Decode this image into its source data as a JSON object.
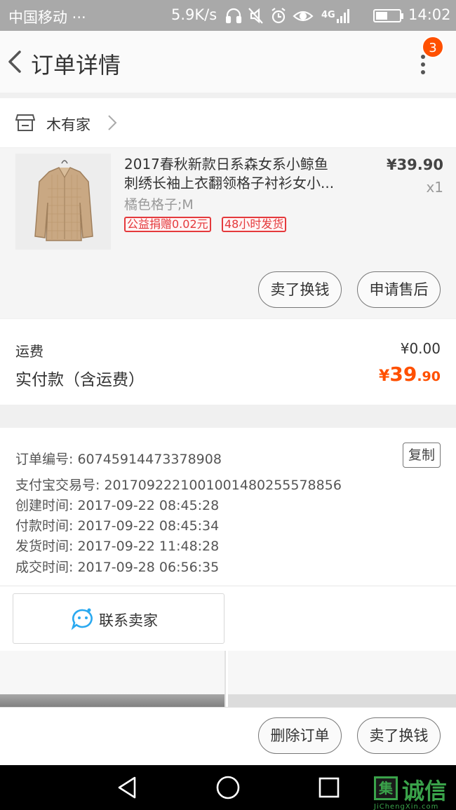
{
  "status_bar": {
    "carrier": "中国移动 ···",
    "network_speed": "5.9K/s",
    "signal": "4G",
    "battery_level": 0.5,
    "time": "14:02"
  },
  "header": {
    "title": "订单详情",
    "notification_count": "3"
  },
  "shop": {
    "name": "木有家"
  },
  "product": {
    "title_line1": "2017春秋新款日系森女系小鲸鱼",
    "title_line2": "刺绣长袖上衣翻领格子衬衫女小...",
    "variant": "橘色格子;M",
    "tags": [
      "公益捐赠0.02元",
      "48小时发货"
    ],
    "price": "¥39.90",
    "quantity": "x1",
    "sell_button": "卖了换钱",
    "after_sale_button": "申请售后"
  },
  "totals": {
    "shipping_label": "运费",
    "shipping_value": "¥0.00",
    "paid_label": "实付款（含运费）",
    "paid_symbol": "¥",
    "paid_integer": "39",
    "paid_decimal": ".90"
  },
  "order_info": {
    "order_no": "订单编号: 60745914473378908",
    "copy_button": "复制",
    "alipay_no": "支付宝交易号: 2017092221001001480255578856",
    "created": "创建时间: 2017-09-22 08:45:28",
    "paid": "付款时间: 2017-09-22 08:45:34",
    "shipped": "发货时间: 2017-09-22 11:48:28",
    "completed": "成交时间: 2017-09-28 06:56:35"
  },
  "contact": {
    "label": "联系卖家"
  },
  "bottom_bar": {
    "delete_button": "删除订单",
    "sell_button": "卖了换钱"
  },
  "watermark": {
    "box_char": "集",
    "text": "诚信",
    "sub": "JiChengXin.com"
  },
  "colors": {
    "accent": "#ff5000",
    "tag_red": "#e4393c",
    "contact_blue": "#2aa9f0"
  }
}
